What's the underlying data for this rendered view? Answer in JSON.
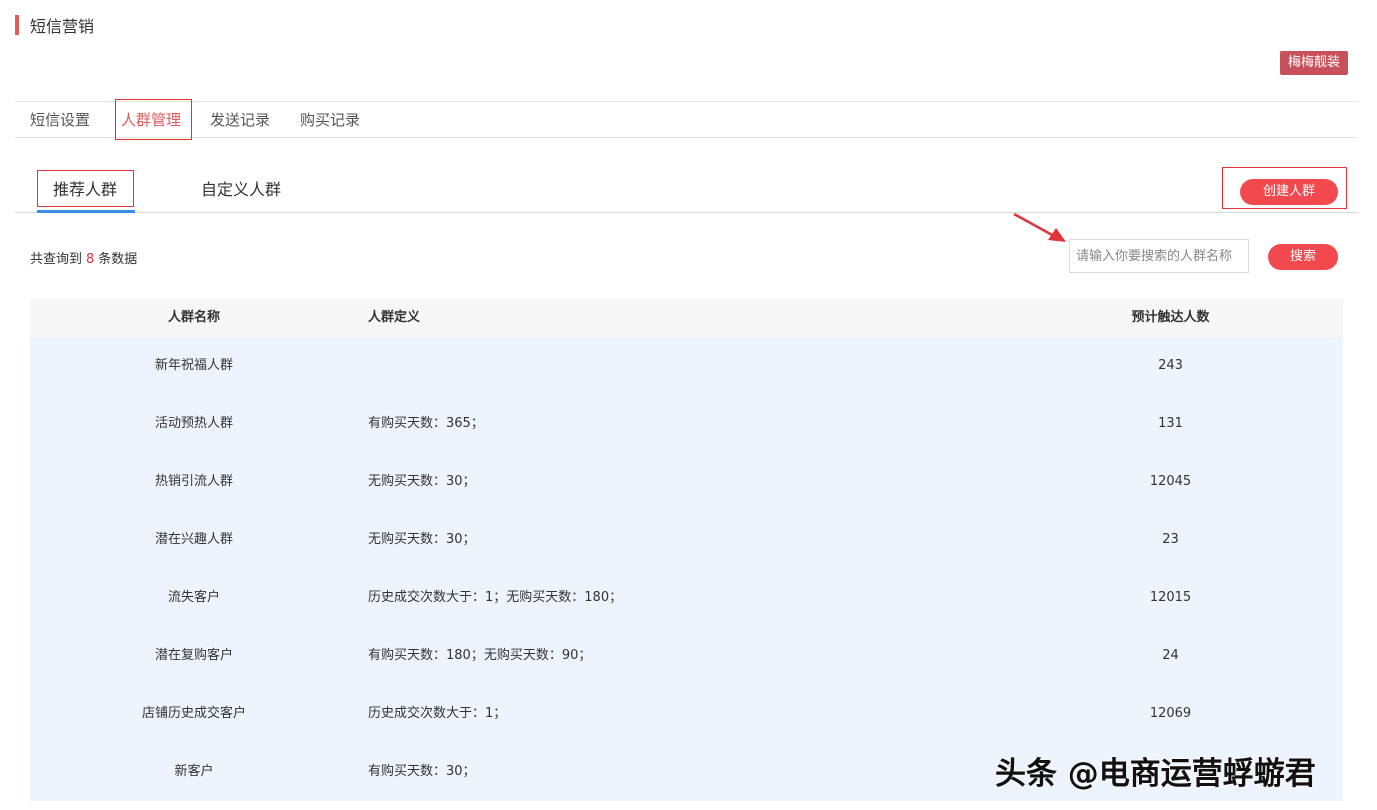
{
  "page": {
    "title": "短信营销"
  },
  "shop": {
    "name": "梅梅靓装"
  },
  "main_tabs": [
    {
      "label": "短信设置"
    },
    {
      "label": "人群管理"
    },
    {
      "label": "发送记录"
    },
    {
      "label": "购买记录"
    }
  ],
  "main_tabs_selected": "人群管理",
  "sub_tabs": [
    {
      "label": "推荐人群"
    },
    {
      "label": "自定义人群"
    }
  ],
  "sub_tabs_selected": "推荐人群",
  "create_button": {
    "label": "创建人群"
  },
  "result": {
    "prefix": "共查询到",
    "count": "8",
    "suffix": "条数据"
  },
  "search": {
    "placeholder": "请输入你要搜索的人群名称",
    "value": "",
    "button_label": "搜索"
  },
  "table": {
    "headers": [
      "人群名称",
      "人群定义",
      "预计触达人数"
    ],
    "rows": [
      {
        "name": "新年祝福人群",
        "definition": "",
        "reach": "243"
      },
      {
        "name": "活动预热人群",
        "definition": "有购买天数：365；",
        "reach": "131"
      },
      {
        "name": "热销引流人群",
        "definition": "无购买天数：30；",
        "reach": "12045"
      },
      {
        "name": "潜在兴趣人群",
        "definition": "无购买天数：30；",
        "reach": "23"
      },
      {
        "name": "流失客户",
        "definition": "历史成交次数大于：1；无购买天数：180；",
        "reach": "12015"
      },
      {
        "name": "潜在复购客户",
        "definition": "有购买天数：180；无购买天数：90；",
        "reach": "24"
      },
      {
        "name": "店铺历史成交客户",
        "definition": "历史成交次数大于：1；",
        "reach": "12069"
      },
      {
        "name": "新客户",
        "definition": "有购买天数：30；",
        "reach": ""
      }
    ]
  },
  "watermark": {
    "text": "头条 @电商运营蜉蝣君"
  },
  "colors": {
    "accent": "#f2494f",
    "active_tab": "#e05a5a",
    "annotation": "#e0333a",
    "underline": "#3a8ee6",
    "table_body": "#edf4fe"
  }
}
